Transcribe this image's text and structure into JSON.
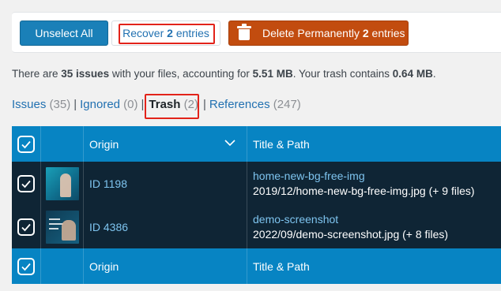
{
  "toolbar": {
    "unselect_label": "Unselect All",
    "recover_prefix": "Recover ",
    "recover_count": "2",
    "recover_suffix": " entries",
    "delete_prefix": "Delete Permanently ",
    "delete_count": "2",
    "delete_suffix": " entries"
  },
  "summary": {
    "part1": "There are ",
    "issues": "35 issues",
    "part2": " with your files, accounting for ",
    "size": "5.51 MB",
    "part3": ". Your trash contains ",
    "trash_size": "0.64 MB",
    "part4": "."
  },
  "tabs": [
    {
      "label": "Issues",
      "count": "(35)"
    },
    {
      "label": "Ignored",
      "count": "(0)"
    },
    {
      "label": "Trash",
      "count": "(2)"
    },
    {
      "label": "References",
      "count": "(247)"
    }
  ],
  "tab_separator": "|",
  "table": {
    "columns": {
      "origin": "Origin",
      "title_path": "Title & Path"
    },
    "rows": [
      {
        "origin": "ID 1198",
        "title": "home-new-bg-free-img",
        "path": "2019/12/home-new-bg-free-img.jpg (+ 9 files)"
      },
      {
        "origin": "ID 4386",
        "title": "demo-screenshot",
        "path": "2022/09/demo-screenshot.jpg (+ 8 files)"
      }
    ]
  },
  "colors": {
    "primary": "#1a80b8",
    "danger": "#c24c0f",
    "header": "#0784c3",
    "row_bg": "#0f2535",
    "highlight": "#e2231a"
  },
  "icons": [
    "trash-icon",
    "checkbox-checked-icon",
    "chevron-down-icon"
  ]
}
